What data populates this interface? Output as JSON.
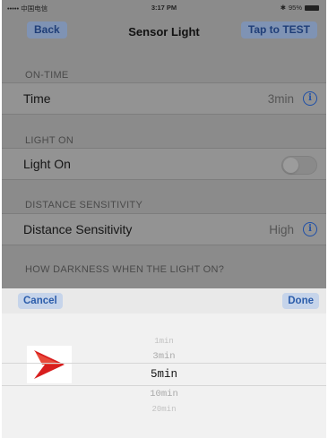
{
  "status_bar": {
    "carrier": "••••• 中国电信 ",
    "time": "3:17 PM",
    "battery": "95%"
  },
  "nav": {
    "back_label": "Back",
    "title": "Sensor Light",
    "test_label": "Tap to TEST"
  },
  "sections": {
    "on_time": {
      "header": "ON-TIME",
      "label": "Time",
      "value": "3min"
    },
    "light_on": {
      "header": "LIGHT ON",
      "label": "Light On",
      "toggle_on": false
    },
    "distance": {
      "header": "DISTANCE SENSITIVITY",
      "label": "Distance Sensitivity",
      "value": "High"
    },
    "darkness": {
      "header": "HOW DARKNESS WHEN THE LIGHT ON?"
    }
  },
  "picker": {
    "cancel_label": "Cancel",
    "done_label": "Done",
    "options": [
      "1min",
      "3min",
      "5min",
      "10min",
      "20min"
    ],
    "selected": "5min"
  },
  "colors": {
    "accent": "#2c5dab",
    "dim_overlay": "#8b8b8b",
    "arrow": "#d81e1e"
  }
}
